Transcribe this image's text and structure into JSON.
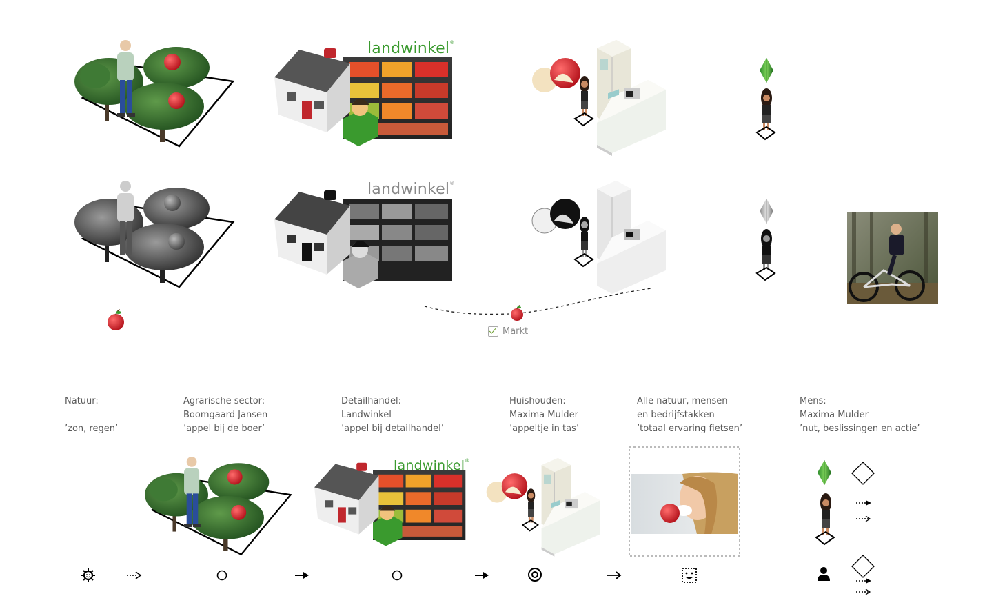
{
  "brand": {
    "name": "landwinkel",
    "registered": "®"
  },
  "market": {
    "label": "Markt",
    "checked": true
  },
  "columns": [
    {
      "line1": "Natuur:",
      "line2": "",
      "line3": "’zon, regen’"
    },
    {
      "line1": "Agrarische sector:",
      "line2": "Boomgaard Jansen",
      "line3": "’appel bij de boer’"
    },
    {
      "line1": "Detailhandel:",
      "line2": "Landwinkel",
      "line3": "’appel bij detailhandel’"
    },
    {
      "line1": "Huishouden:",
      "line2": "Maxima Mulder",
      "line3": "’appeltje in tas’"
    },
    {
      "line1": "Alle natuur, mensen",
      "line2": "en bedrijfstakken",
      "line3": "’totaal ervaring fietsen’"
    },
    {
      "line1": "Mens:",
      "line2": "Maxima Mulder",
      "line3": "’nut, beslissingen en actie’"
    }
  ],
  "flow_icons": [
    "sun-icon",
    "dotted-arrow-icon",
    "circle-icon",
    "arrow-icon",
    "circle-icon",
    "arrow-icon",
    "target-circle-icon",
    "thin-arrow-icon",
    "smiley-box-icon",
    "person-icon"
  ],
  "colors": {
    "brand_green": "#3a9a2e",
    "brand_red": "#c0272d",
    "apple_red": "#d2232a",
    "plumbob_green": "#3fae3a"
  }
}
